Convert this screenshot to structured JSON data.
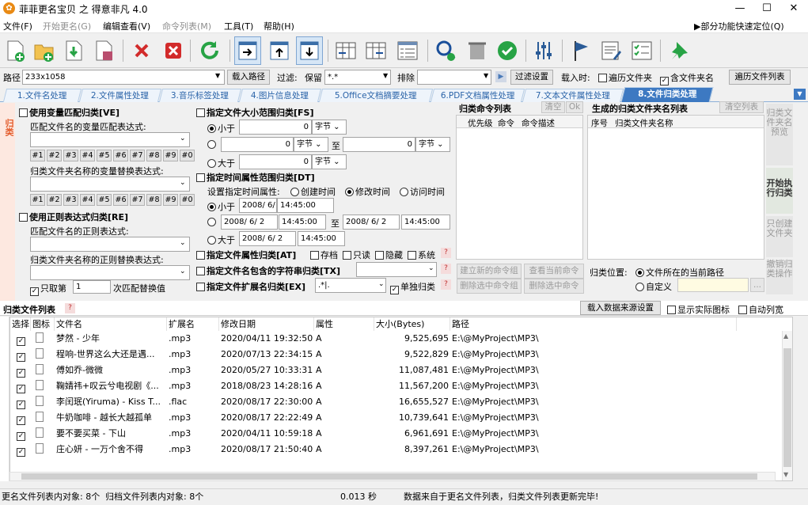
{
  "window": {
    "title": "菲菲更名宝贝 之 得意非凡 4.0"
  },
  "menu": [
    {
      "label": "文件(F)",
      "enabled": true
    },
    {
      "label": "开始更名(G)",
      "enabled": false
    },
    {
      "label": "编辑查看(V)",
      "enabled": true
    },
    {
      "label": "命令列表(M)",
      "enabled": false
    },
    {
      "label": "工具(T)",
      "enabled": true
    },
    {
      "label": "帮助(H)",
      "enabled": true
    }
  ],
  "menu_right": "▶部分功能快速定位(Q)",
  "pathbar": {
    "path_label": "路径",
    "path_value": "233x1058",
    "load_path": "载入路径",
    "filter_label": "过滤:",
    "keep_label": "保留",
    "keep_value": "*.*",
    "exclude_label": "排除",
    "filter_settings": "过滤设置",
    "load_time_label": "载入时:",
    "traverse_folders": "遍历文件夹",
    "include_folder_names": "含文件夹名",
    "traverse_list": "遍历文件列表"
  },
  "tabs": [
    "1.文件名处理",
    "2.文件属性处理",
    "3.音乐标签处理",
    "4.图片信息处理",
    "5.Office文档摘要处理",
    "6.PDF文档属性处理",
    "7.文本文件属性处理",
    "8.文件归类处理"
  ],
  "sidebar_label": "归类",
  "ve": {
    "title": "使用变量匹配归类[VE]",
    "match_label": "匹配文件名的变量匹配表达式:",
    "replace_label": "归类文件夹名称的变量替换表达式:",
    "nums": [
      "#1",
      "#2",
      "#3",
      "#4",
      "#5",
      "#6",
      "#7",
      "#8",
      "#9",
      "#0"
    ]
  },
  "re": {
    "title": "使用正则表达式归类[RE]",
    "match_label": "匹配文件名的正则表达式:",
    "replace_label": "归类文件夹名称的正则替换表达式:",
    "only_take": "只取第",
    "only_take_value": "1",
    "match_replace": "次匹配替换值"
  },
  "fs": {
    "title": "指定文件大小范围归类[FS]",
    "less": "小于",
    "greater": "大于",
    "to": "至",
    "unit": "字节",
    "zero": "0"
  },
  "dt": {
    "title": "指定时间属性范围归类[DT]",
    "set_label": "设置指定时间属性:",
    "create": "创建时间",
    "modify": "修改时间",
    "access": "访问时间",
    "less": "小于",
    "greater": "大于",
    "to": "至",
    "date": "2008/ 6/ 2",
    "time": "14:45:00"
  },
  "at": {
    "title": "指定文件属性归类[AT]",
    "archive": "存档",
    "readonly": "只读",
    "hidden": "隐藏",
    "system": "系统"
  },
  "tx": {
    "title": "指定文件名包含的字符串归类[TX]"
  },
  "ex": {
    "title": "指定文件扩展名归类[EX]",
    "value": ".*|.",
    "single": "单独归类"
  },
  "help_mark": "?",
  "cmd_list": {
    "title": "归类命令列表",
    "clear": "清空",
    "ok": "Ok",
    "cols": [
      "优先级",
      "命令",
      "命令描述"
    ],
    "new_cmd": "建立新的命令组",
    "view_cmd": "查看当前命令",
    "del_sel": "删除选中命令组",
    "del_cmd": "删除选中命令"
  },
  "folder_list": {
    "title": "生成的归类文件夹名列表",
    "clear_list": "清空列表",
    "cols": [
      "序号",
      "归类文件夹名称"
    ],
    "location_label": "归类位置:",
    "loc_current": "文件所在的当前路径",
    "loc_custom": "自定义",
    "browse": "..."
  },
  "right_buttons": [
    "归类文件夹名预览",
    "开始执行归类",
    "只创建文件夹",
    "撤销归类操作"
  ],
  "list_section": {
    "title": "归类文件列表",
    "help": "?",
    "load_source": "载入数据来源设置",
    "show_icons": "显示实际图标",
    "auto_width": "自动列宽"
  },
  "grid": {
    "columns": [
      "选择",
      "图标",
      "文件名",
      "扩展名",
      "修改日期",
      "属性",
      "大小(Bytes)",
      "路径"
    ],
    "rows": [
      {
        "name": "梦然 - 少年",
        "ext": ".mp3",
        "date": "2020/04/11 19:32:50",
        "attr": "A",
        "size": "9,525,695",
        "path": "E:\\@MyProject\\MP3\\"
      },
      {
        "name": "程响-世界这么大还是遇...",
        "ext": ".mp3",
        "date": "2020/07/13 22:34:15",
        "attr": "A",
        "size": "9,522,829",
        "path": "E:\\@MyProject\\MP3\\"
      },
      {
        "name": "傅如乔-微微",
        "ext": ".mp3",
        "date": "2020/05/27 10:33:31",
        "attr": "A",
        "size": "11,087,481",
        "path": "E:\\@MyProject\\MP3\\"
      },
      {
        "name": "鞠婧祎+叹云兮电视剧《...",
        "ext": ".mp3",
        "date": "2018/08/23 14:28:16",
        "attr": "A",
        "size": "11,567,200",
        "path": "E:\\@MyProject\\MP3\\"
      },
      {
        "name": "李闰珉(Yiruma) - Kiss T...",
        "ext": ".flac",
        "date": "2020/08/17 22:30:00",
        "attr": "A",
        "size": "16,655,527",
        "path": "E:\\@MyProject\\MP3\\"
      },
      {
        "name": "牛奶咖啡 - 越长大越孤单",
        "ext": ".mp3",
        "date": "2020/08/17 22:22:49",
        "attr": "A",
        "size": "10,739,641",
        "path": "E:\\@MyProject\\MP3\\"
      },
      {
        "name": "要不要买菜 - 下山",
        "ext": ".mp3",
        "date": "2020/04/11 10:59:18",
        "attr": "A",
        "size": "6,961,691",
        "path": "E:\\@MyProject\\MP3\\"
      },
      {
        "name": "庄心妍 - 一万个舍不得",
        "ext": ".mp3",
        "date": "2020/08/17 21:50:40",
        "attr": "A",
        "size": "8,397,261",
        "path": "E:\\@MyProject\\MP3\\"
      }
    ]
  },
  "status": {
    "left": "更名文件列表内对象: 8个",
    "mid": "归档文件列表内对象: 8个",
    "time": "0.013 秒",
    "msg": "数据来自于更名文件列表，归类文件列表更新完毕!"
  },
  "accent": "#3d79c2"
}
